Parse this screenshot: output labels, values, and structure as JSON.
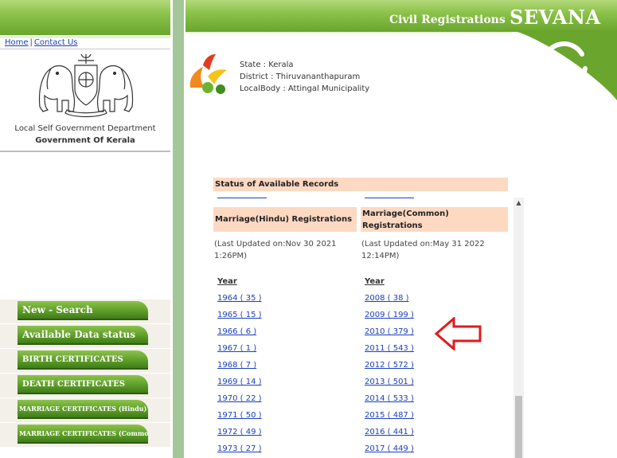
{
  "nav": {
    "home_label": "Home",
    "separator": "|",
    "contact_label": "Contact Us"
  },
  "org": {
    "department": "Local Self Government Department",
    "government": "Government Of Kerala"
  },
  "menu": [
    {
      "label": "New - Search",
      "size": "lg"
    },
    {
      "label": "Available Data status",
      "size": "lg"
    },
    {
      "label": "BIRTH CERTIFICATES",
      "size": "md"
    },
    {
      "label": "DEATH CERTIFICATES",
      "size": "md"
    },
    {
      "label": "MARRIAGE CERTIFICATES (Hindu)",
      "size": "sm"
    },
    {
      "label": "MARRIAGE CERTIFICATES (Common)",
      "size": "sm"
    }
  ],
  "header": {
    "section_title": "Civil Registrations",
    "brand": "SEVANA"
  },
  "location": {
    "state": "State : Kerala",
    "district": "District : Thiruvananthapuram",
    "local_body": "LocalBody : Attingal Municipality"
  },
  "records": {
    "status_title": "Status of Available Records",
    "hindu": {
      "title": "Marriage(Hindu) Registrations",
      "updated_line1": "(Last Updated on:Nov 30 2021",
      "updated_line2": "1:26PM)",
      "year_header": "Year",
      "years": [
        "1964 ( 35 )",
        "1965 ( 15 )",
        "1966 ( 6 )",
        "1967 ( 1 )",
        "1968 ( 7 )",
        "1969 ( 14 )",
        "1970 ( 22 )",
        "1971 ( 50 )",
        "1972 ( 49 )",
        "1973 ( 27 )"
      ]
    },
    "common": {
      "title_line1": "Marriage(Common)",
      "title_line2": "Registrations",
      "updated_line1": "(Last Updated on:May 31 2022",
      "updated_line2": "12:14PM)",
      "year_header": "Year",
      "years": [
        "2008 ( 38 )",
        "2009 ( 199 )",
        "2010 ( 379 )",
        "2011 ( 543 )",
        "2012 ( 572 )",
        "2013 ( 501 )",
        "2014 ( 533 )",
        "2015 ( 487 )",
        "2016 ( 441 )",
        "2017 ( 449 )"
      ]
    }
  },
  "colors": {
    "header_green": "#6aa52e",
    "panel_peach": "#fdd9c2",
    "link_blue": "#1a3fbf",
    "arrow_red": "#e01b1b"
  }
}
